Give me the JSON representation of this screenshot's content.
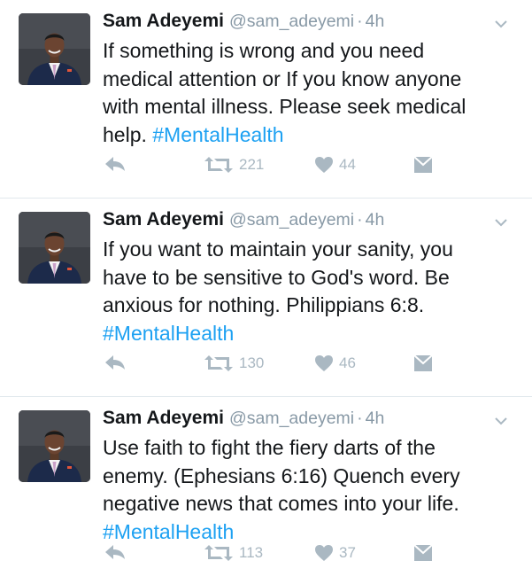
{
  "tweets": [
    {
      "author": {
        "name": "Sam Adeyemi",
        "handle": "@sam_adeyemi",
        "separator": "·",
        "time": "4h"
      },
      "text": "If something is wrong and you need\nmedical attention or If you know anyone\nwith mental illness. Please seek medical\nhelp. ",
      "hashtag": "#MentalHealth",
      "retweets": "221",
      "likes": "44"
    },
    {
      "author": {
        "name": "Sam Adeyemi",
        "handle": "@sam_adeyemi",
        "separator": "·",
        "time": "4h"
      },
      "text": "If you want to maintain your sanity, you\nhave to be sensitive to God's word. Be\nanxious for nothing. Philippians 6:8.\n",
      "hashtag": "#MentalHealth",
      "retweets": "130",
      "likes": "46"
    },
    {
      "author": {
        "name": "Sam Adeyemi",
        "handle": "@sam_adeyemi",
        "separator": "·",
        "time": "4h"
      },
      "text": "Use faith to fight the fiery darts of the\nenemy. (Ephesians 6:16) Quench every\nnegative news that comes into your life.\n",
      "hashtag": "#MentalHealth",
      "retweets": "113",
      "likes": "37"
    }
  ],
  "icons": {
    "reply": "reply-icon",
    "retweet": "retweet-icon",
    "like": "heart-icon",
    "message": "direct-message-icon",
    "more": "chevron-down-icon"
  },
  "colors": {
    "text": "#14171a",
    "muted": "#8899a6",
    "action": "#aab8c2",
    "link": "#1da1f2",
    "divider": "#e1e8ed"
  }
}
